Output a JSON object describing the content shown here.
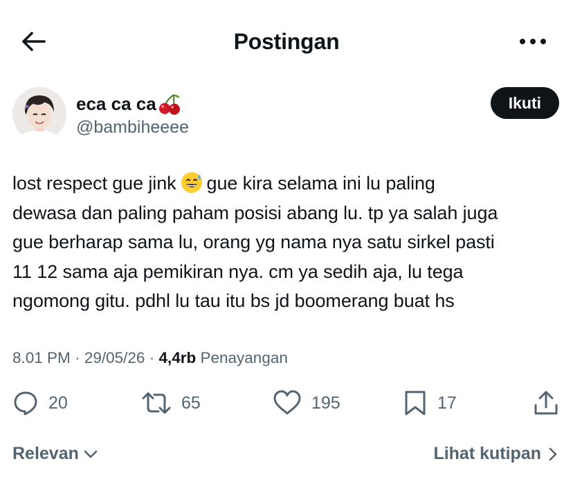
{
  "header": {
    "title": "Postingan",
    "back_icon": "arrow-left-icon",
    "more_icon": "more-horizontal-icon"
  },
  "author": {
    "display_name": "eca ca ca",
    "display_name_emoji": "cherries-emoji",
    "handle": "@bambiheeee",
    "follow_label": "Ikuti"
  },
  "tweet": {
    "lines": [
      {
        "before": "lost respect gue jink",
        "emoji": "grinning-sweat-emoji",
        "after": "gue kira selama ini lu paling"
      },
      {
        "text": "dewasa dan paling paham posisi abang lu. tp ya salah juga"
      },
      {
        "text": "gue berharap sama lu, orang yg nama nya satu sirkel pasti"
      },
      {
        "text": "11 12 sama aja pemikiran nya. cm ya sedih aja, lu tega"
      },
      {
        "text": "ngomong gitu. pdhl lu tau itu bs jd boomerang buat hs"
      }
    ]
  },
  "meta": {
    "time": "8.01 PM",
    "sep1": "·",
    "date": "29/05/26",
    "sep2": "·",
    "views_count": "4,4rb",
    "views_label": "Penayangan"
  },
  "actions": {
    "replies": "20",
    "reposts": "65",
    "likes": "195",
    "bookmarks": "17"
  },
  "footer": {
    "sort_label": "Relevan",
    "quotes_label": "Lihat kutipan"
  },
  "colors": {
    "text": "#0f1419",
    "secondary": "#536471",
    "button_bg": "#0f1419"
  }
}
